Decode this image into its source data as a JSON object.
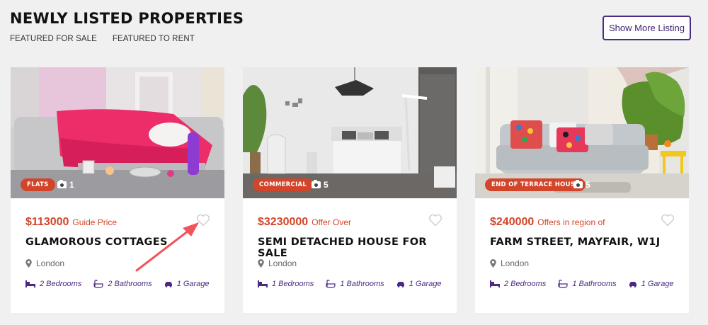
{
  "header": {
    "title": "NEWLY LISTED PROPERTIES",
    "tabs": [
      "FEATURED FOR SALE",
      "FEATURED TO RENT"
    ],
    "show_more": "Show More Listing"
  },
  "colors": {
    "accent": "#d2452a",
    "purple": "#4b2a85",
    "background": "#f0f0f0"
  },
  "cards": [
    {
      "badge": "FLATS",
      "photo_count": "1",
      "price": "$113000",
      "price_note": "Guide Price",
      "title": "GLAMOROUS COTTAGES",
      "location": "London",
      "bedrooms": "2 Bedrooms",
      "bathrooms": "2 Bathrooms",
      "garage": "1 Garage"
    },
    {
      "badge": "COMMERCIAL",
      "photo_count": "5",
      "price": "$3230000",
      "price_note": "Offer Over",
      "title": "SEMI DETACHED HOUSE FOR SALE",
      "location": "London",
      "bedrooms": "1 Bedrooms",
      "bathrooms": "1 Bathrooms",
      "garage": "1 Garage"
    },
    {
      "badge": "END OF TERRACE HOUSE",
      "photo_count": "5",
      "price": "$240000",
      "price_note": "Offers in region of",
      "title": "FARM STREET, MAYFAIR, W1J",
      "location": "London",
      "bedrooms": "2 Bedrooms",
      "bathrooms": "1 Bathrooms",
      "garage": "1 Garage"
    }
  ],
  "icons": {
    "camera": "camera-icon",
    "heart": "heart-icon",
    "pin": "map-pin-icon",
    "bed": "bed-icon",
    "bath": "bath-icon",
    "car": "car-icon"
  }
}
